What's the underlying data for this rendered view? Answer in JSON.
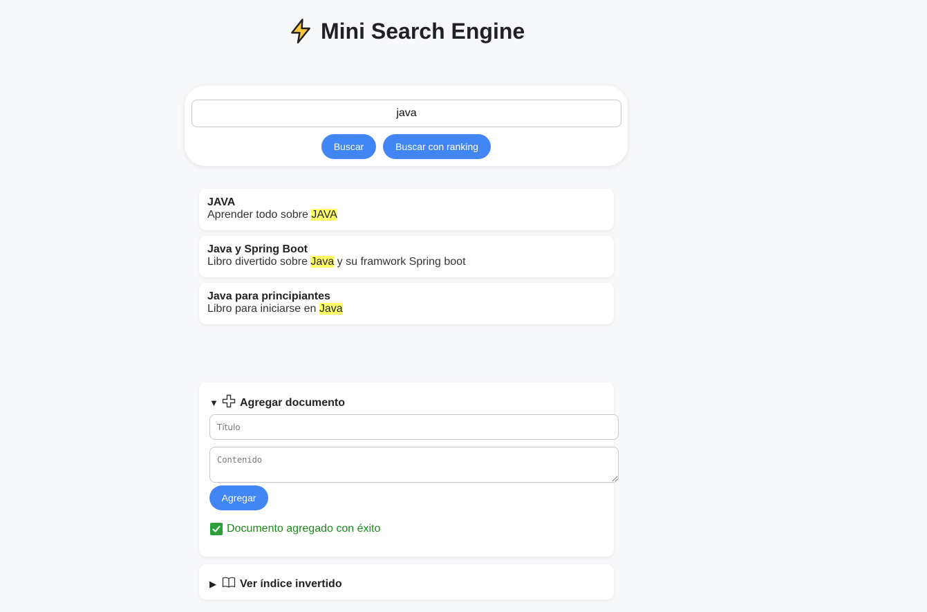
{
  "header": {
    "title": "Mini Search Engine",
    "icon": "lightning-icon"
  },
  "search": {
    "value": "java",
    "buscar_label": "Buscar",
    "ranking_label": "Buscar con ranking"
  },
  "results": [
    {
      "title": "JAVA",
      "snippet_before": "Aprender todo sobre ",
      "snippet_match": "JAVA",
      "snippet_after": ""
    },
    {
      "title": "Java y Spring Boot",
      "snippet_before": "Libro divertido sobre ",
      "snippet_match": "Java",
      "snippet_after": " y su framwork Spring boot"
    },
    {
      "title": "Java para principiantes",
      "snippet_before": "Libro para iniciarse en ",
      "snippet_match": "Java",
      "snippet_after": ""
    }
  ],
  "add_document": {
    "caret": "▼",
    "icon": "plus-icon",
    "label": "Agregar documento",
    "titulo_placeholder": "Título",
    "contenido_placeholder": "Contenido",
    "submit_label": "Agregar",
    "status_icon": "check-icon",
    "status_text": "Documento agregado con éxito"
  },
  "inverted_index": {
    "caret": "▶",
    "icon": "book-icon",
    "label": "Ver índice invertido"
  },
  "colors": {
    "accent": "#4285f4",
    "highlight": "#ffff66",
    "success": "#1a8a1a",
    "background": "#f7f8fa"
  }
}
